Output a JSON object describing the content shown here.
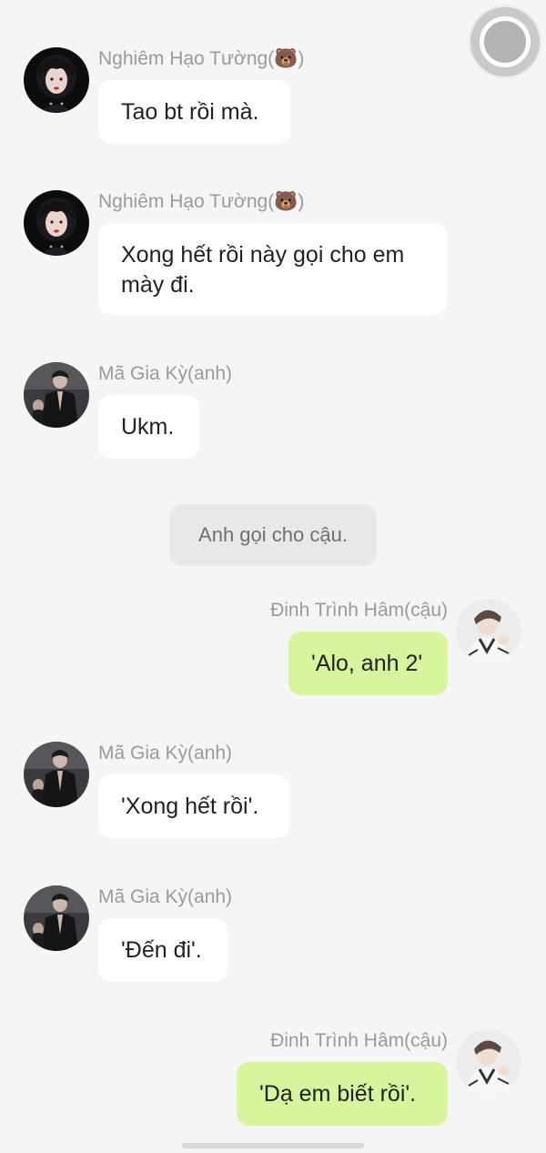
{
  "messages": [
    {
      "sender": "Nghiêm Hạo Tường(🐻)",
      "text": "Tao bt rồi mà.",
      "side": "left",
      "avatar": "avatar-nghiem"
    },
    {
      "sender": "Nghiêm Hạo Tường(🐻)",
      "text": "Xong hết rồi này gọi cho em mày đi.",
      "side": "left",
      "avatar": "avatar-nghiem"
    },
    {
      "sender": "Mã Gia Kỳ(anh)",
      "text": "Ukm.",
      "side": "left",
      "avatar": "avatar-ma"
    },
    {
      "sender": "Đinh Trình Hâm(cậu)",
      "text": "'Alo, anh 2'",
      "side": "right",
      "avatar": "avatar-dinh"
    },
    {
      "sender": "Mã Gia Kỳ(anh)",
      "text": "'Xong hết rồi'.",
      "side": "left",
      "avatar": "avatar-ma"
    },
    {
      "sender": "Mã Gia Kỳ(anh)",
      "text": "'Đến đi'.",
      "side": "left",
      "avatar": "avatar-ma"
    },
    {
      "sender": "Đinh Trình Hâm(cậu)",
      "text": "'Dạ em biết rồi'.",
      "side": "right",
      "avatar": "avatar-dinh"
    }
  ],
  "system_note": "Anh gọi cho cậu.",
  "colors": {
    "background": "#f5f5f5",
    "incoming_bubble": "#ffffff",
    "outgoing_bubble": "#d6f59c",
    "system_note_bg": "#e8e8e8",
    "name_text": "#9a9a9a"
  },
  "icons": {
    "floating_assistant": "floating-ball-icon",
    "battery": "battery-charging-icon"
  }
}
